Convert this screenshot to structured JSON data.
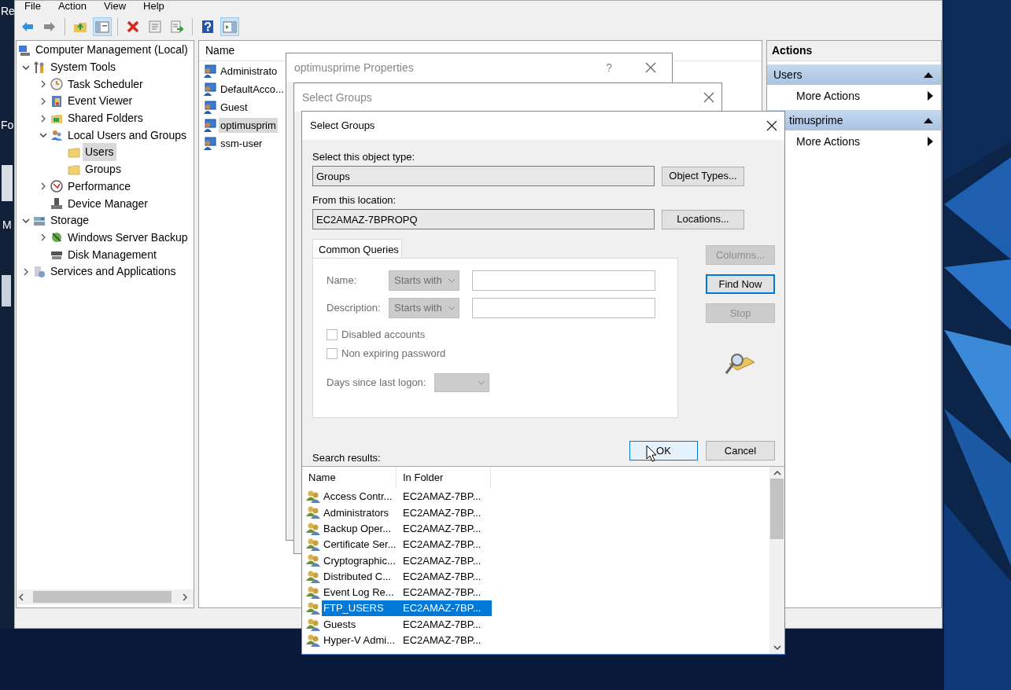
{
  "desktop_icons": [
    {
      "label": "Re"
    },
    {
      "label": "Fo"
    },
    {
      "label": "M"
    }
  ],
  "main_window": {
    "menu": [
      "File",
      "Action",
      "View",
      "Help"
    ],
    "toolbar": [
      {
        "kind": "back",
        "pressed": false
      },
      {
        "kind": "forward",
        "pressed": false
      },
      {
        "kind": "separator"
      },
      {
        "kind": "up",
        "pressed": false
      },
      {
        "kind": "tree",
        "pressed": true
      },
      {
        "kind": "separator"
      },
      {
        "kind": "delete",
        "pressed": false
      },
      {
        "kind": "properties",
        "pressed": false
      },
      {
        "kind": "export",
        "pressed": false
      },
      {
        "kind": "separator"
      },
      {
        "kind": "help",
        "pressed": false
      },
      {
        "kind": "actionpane",
        "pressed": true
      }
    ],
    "tree": [
      {
        "label": "Computer Management (Local)",
        "selected": false,
        "children": [
          {
            "label": "System Tools",
            "selected": false,
            "expanded": true,
            "children": [
              {
                "label": "Task Scheduler",
                "selected": false,
                "expanded": false
              },
              {
                "label": "Event Viewer",
                "selected": false,
                "expanded": false
              },
              {
                "label": "Shared Folders",
                "selected": false,
                "expanded": false
              },
              {
                "label": "Local Users and Groups",
                "selected": false,
                "expanded": true,
                "children": [
                  {
                    "label": "Users",
                    "selected": true
                  },
                  {
                    "label": "Groups",
                    "selected": false
                  }
                ]
              },
              {
                "label": "Performance",
                "selected": false,
                "expanded": false
              },
              {
                "label": "Device Manager",
                "selected": false
              }
            ]
          },
          {
            "label": "Storage",
            "selected": false,
            "expanded": true,
            "children": [
              {
                "label": "Windows Server Backup",
                "selected": false,
                "expanded": false
              },
              {
                "label": "Disk Management",
                "selected": false
              }
            ]
          },
          {
            "label": "Services and Applications",
            "selected": false,
            "expanded": false
          }
        ]
      }
    ],
    "list": {
      "columns": [
        "Name"
      ],
      "rows": [
        {
          "name": "Administrato",
          "selected": false
        },
        {
          "name": "DefaultAcco...",
          "selected": false
        },
        {
          "name": "Guest",
          "selected": false
        },
        {
          "name": "optimusprim",
          "selected": true
        },
        {
          "name": "ssm-user",
          "selected": false
        }
      ]
    },
    "actions": {
      "title": "Actions",
      "sections": [
        {
          "title": "Users",
          "expanded": true,
          "items": [
            "More Actions"
          ]
        },
        {
          "title": "timusprime",
          "expanded": true,
          "items": [
            "More Actions"
          ]
        }
      ]
    }
  },
  "properties_dialog": {
    "title": "optimusprime Properties",
    "help": "?"
  },
  "background_dialog": {
    "title": "Select Groups"
  },
  "dialog": {
    "title": "Select Groups",
    "object_type_label": "Select this object type:",
    "object_type": "Groups",
    "object_types_button": "Object Types...",
    "location_label": "From this location:",
    "location": "EC2AMAZ-7BPROPQ",
    "locations_button": "Locations...",
    "tab": "Common Queries",
    "queries": {
      "disabled": true,
      "name_label": "Name:",
      "name_match": "Starts with",
      "description_label": "Description:",
      "description_match": "Starts with",
      "checkboxes": [
        {
          "label": "Disabled accounts",
          "checked": false
        },
        {
          "label": "Non expiring password",
          "checked": false
        }
      ],
      "days_label": "Days since last logon:"
    },
    "side_buttons": [
      {
        "label": "Columns...",
        "disabled": true,
        "default": false
      },
      {
        "label": "Find Now",
        "disabled": false,
        "default": true
      },
      {
        "label": "Stop",
        "disabled": true,
        "default": false
      }
    ],
    "ok": {
      "label": "OK",
      "hovered": true
    },
    "cancel": {
      "label": "Cancel",
      "hovered": false
    },
    "results_label": "Search results:",
    "results": {
      "columns": [
        "Name",
        "In Folder"
      ],
      "rows": [
        {
          "name": "Access Contr...",
          "folder": "EC2AMAZ-7BP...",
          "selected": false
        },
        {
          "name": "Administrators",
          "folder": "EC2AMAZ-7BP...",
          "selected": false
        },
        {
          "name": "Backup Oper...",
          "folder": "EC2AMAZ-7BP...",
          "selected": false
        },
        {
          "name": "Certificate Ser...",
          "folder": "EC2AMAZ-7BP...",
          "selected": false
        },
        {
          "name": "Cryptographic...",
          "folder": "EC2AMAZ-7BP...",
          "selected": false
        },
        {
          "name": "Distributed C...",
          "folder": "EC2AMAZ-7BP...",
          "selected": false
        },
        {
          "name": "Event Log Re...",
          "folder": "EC2AMAZ-7BP...",
          "selected": false
        },
        {
          "name": "FTP_USERS",
          "folder": "EC2AMAZ-7BP...",
          "selected": true
        },
        {
          "name": "Guests",
          "folder": "EC2AMAZ-7BP...",
          "selected": false
        },
        {
          "name": "Hyper-V Admi...",
          "folder": "EC2AMAZ-7BP...",
          "selected": false
        }
      ]
    }
  }
}
